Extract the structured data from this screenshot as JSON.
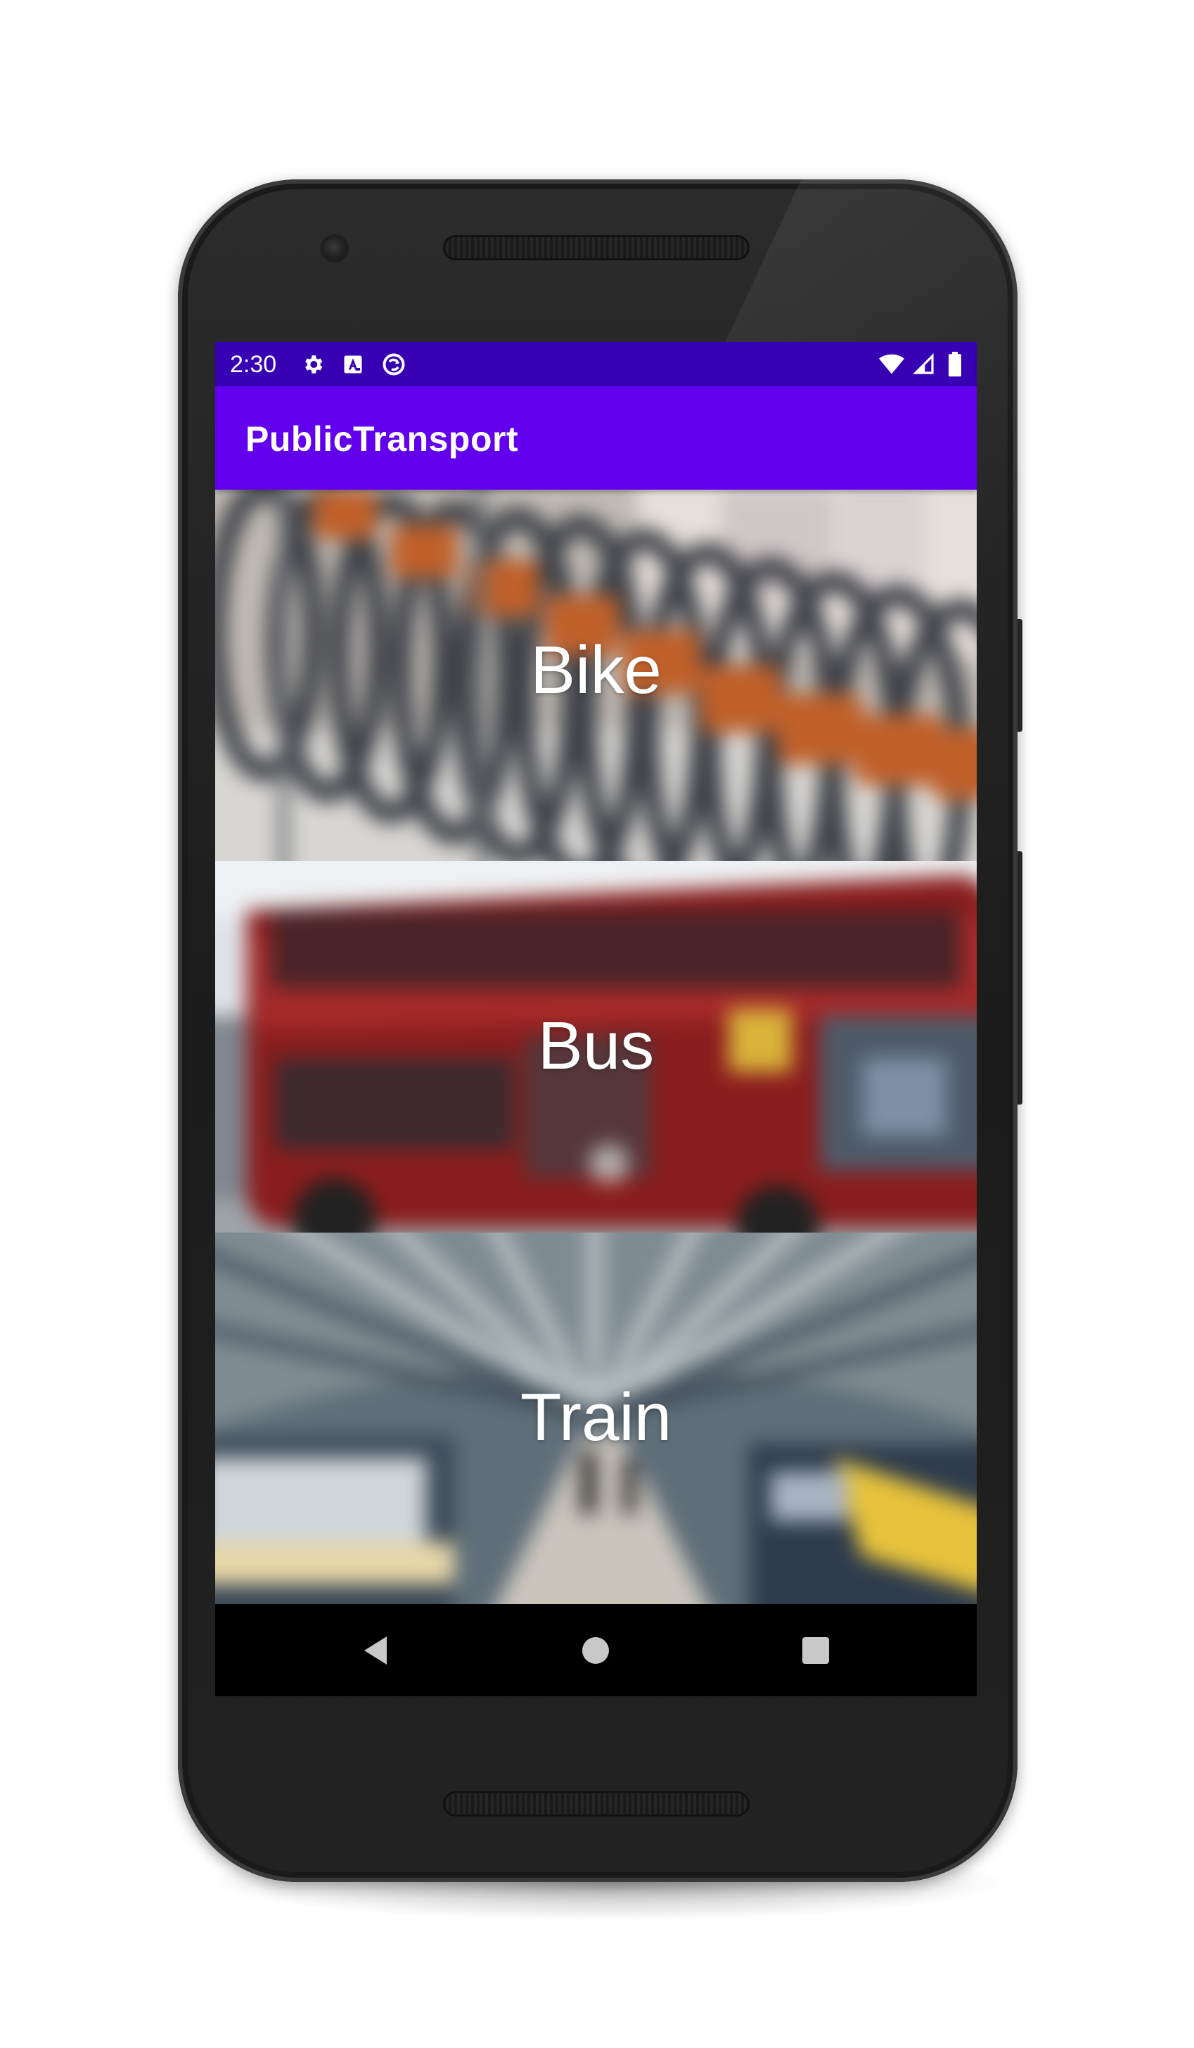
{
  "status_bar": {
    "time": "2:30",
    "left_icons": [
      "gear-icon",
      "a-box-icon",
      "sync-icon"
    ],
    "right_icons": [
      "wifi-icon",
      "signal-icon",
      "battery-icon"
    ],
    "color": "#3700b3"
  },
  "app_bar": {
    "title": "PublicTransport",
    "color": "#6200ee"
  },
  "cards": [
    {
      "label": "Bike"
    },
    {
      "label": "Bus"
    },
    {
      "label": "Train"
    }
  ],
  "nav_bar": {
    "buttons": [
      "back-icon",
      "home-icon",
      "recents-icon"
    ]
  }
}
